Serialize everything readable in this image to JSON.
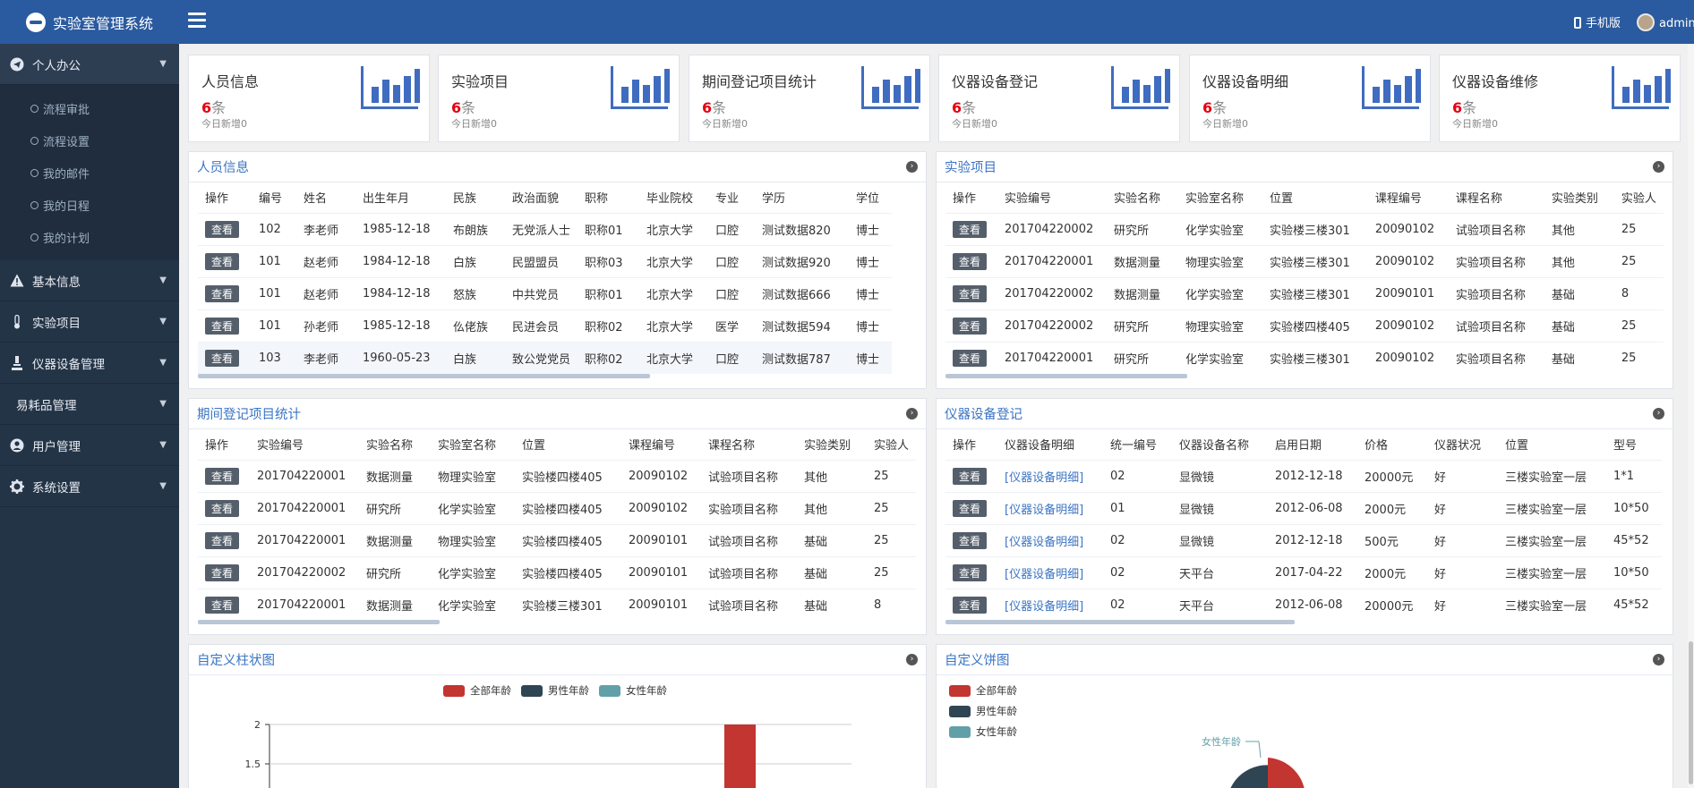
{
  "app": {
    "title": "实验室管理系统"
  },
  "topbar": {
    "mobile_label": "手机版",
    "user": "admin"
  },
  "sidebar": {
    "groups": [
      {
        "label": "个人办公",
        "icon": "send-icon",
        "items": [
          "流程审批",
          "流程设置",
          "我的邮件",
          "我的日程",
          "我的计划"
        ]
      },
      {
        "label": "基本信息",
        "icon": "warning-icon"
      },
      {
        "label": "实验项目",
        "icon": "thermometer-icon"
      },
      {
        "label": "仪器设备管理",
        "icon": "microscope-icon"
      },
      {
        "label": "易耗品管理",
        "icon": ""
      },
      {
        "label": "用户管理",
        "icon": "user-circle-icon"
      },
      {
        "label": "系统设置",
        "icon": "gear-icon"
      }
    ]
  },
  "cards": [
    {
      "title": "人员信息",
      "count": "6",
      "unit": "条",
      "today": "今日新增0"
    },
    {
      "title": "实验项目",
      "count": "6",
      "unit": "条",
      "today": "今日新增0"
    },
    {
      "title": "期间登记项目统计",
      "count": "6",
      "unit": "条",
      "today": "今日新增0"
    },
    {
      "title": "仪器设备登记",
      "count": "6",
      "unit": "条",
      "today": "今日新增0"
    },
    {
      "title": "仪器设备明细",
      "count": "6",
      "unit": "条",
      "today": "今日新增0"
    },
    {
      "title": "仪器设备维修",
      "count": "6",
      "unit": "条",
      "today": "今日新增0"
    }
  ],
  "view_label": "查看",
  "panels": {
    "personnel": {
      "title": "人员信息",
      "columns": [
        "操作",
        "编号",
        "姓名",
        "出生年月",
        "民族",
        "政治面貌",
        "职称",
        "毕业院校",
        "专业",
        "学历",
        "学位"
      ],
      "rows": [
        [
          "102",
          "李老师",
          "1985-12-18",
          "布朗族",
          "无党派人士",
          "职称01",
          "北京大学",
          "口腔",
          "测试数据820",
          "博士"
        ],
        [
          "101",
          "赵老师",
          "1984-12-18",
          "白族",
          "民盟盟员",
          "职称03",
          "北京大学",
          "口腔",
          "测试数据920",
          "博士"
        ],
        [
          "101",
          "赵老师",
          "1984-12-18",
          "怒族",
          "中共党员",
          "职称01",
          "北京大学",
          "口腔",
          "测试数据666",
          "博士"
        ],
        [
          "101",
          "孙老师",
          "1985-12-18",
          "仫佬族",
          "民进会员",
          "职称02",
          "北京大学",
          "医学",
          "测试数据594",
          "博士"
        ],
        [
          "103",
          "李老师",
          "1960-05-23",
          "白族",
          "致公党党员",
          "职称02",
          "北京大学",
          "口腔",
          "测试数据787",
          "博士"
        ]
      ]
    },
    "projects": {
      "title": "实验项目",
      "columns": [
        "操作",
        "实验编号",
        "实验名称",
        "实验室名称",
        "位置",
        "课程编号",
        "课程名称",
        "实验类别",
        "实验人"
      ],
      "rows": [
        [
          "201704220002",
          "研究所",
          "化学实验室",
          "实验楼三楼301",
          "20090102",
          "试验项目名称",
          "其他",
          "25"
        ],
        [
          "201704220001",
          "数据测量",
          "物理实验室",
          "实验楼三楼301",
          "20090102",
          "实验项目名称",
          "其他",
          "25"
        ],
        [
          "201704220002",
          "数据测量",
          "化学实验室",
          "实验楼三楼301",
          "20090101",
          "实验项目名称",
          "基础",
          "8"
        ],
        [
          "201704220002",
          "研究所",
          "物理实验室",
          "实验楼四楼405",
          "20090102",
          "试验项目名称",
          "基础",
          "25"
        ],
        [
          "201704220001",
          "研究所",
          "化学实验室",
          "实验楼三楼301",
          "20090102",
          "实验项目名称",
          "基础",
          "25"
        ]
      ]
    },
    "period": {
      "title": "期间登记项目统计",
      "columns": [
        "操作",
        "实验编号",
        "实验名称",
        "实验室名称",
        "位置",
        "课程编号",
        "课程名称",
        "实验类别",
        "实验人"
      ],
      "rows": [
        [
          "201704220001",
          "数据测量",
          "物理实验室",
          "实验楼四楼405",
          "20090102",
          "试验项目名称",
          "其他",
          "25"
        ],
        [
          "201704220001",
          "研究所",
          "化学实验室",
          "实验楼四楼405",
          "20090102",
          "实验项目名称",
          "其他",
          "25"
        ],
        [
          "201704220001",
          "数据测量",
          "物理实验室",
          "实验楼四楼405",
          "20090101",
          "试验项目名称",
          "基础",
          "25"
        ],
        [
          "201704220002",
          "研究所",
          "化学实验室",
          "实验楼四楼405",
          "20090101",
          "试验项目名称",
          "基础",
          "25"
        ],
        [
          "201704220001",
          "数据测量",
          "化学实验室",
          "实验楼三楼301",
          "20090101",
          "试验项目名称",
          "基础",
          "8"
        ]
      ]
    },
    "equipment": {
      "title": "仪器设备登记",
      "columns": [
        "操作",
        "仪器设备明细",
        "统一编号",
        "仪器设备名称",
        "启用日期",
        "价格",
        "仪器状况",
        "位置",
        "型号"
      ],
      "rows": [
        [
          "[仪器设备明细]",
          "02",
          "显微镜",
          "2012-12-18",
          "20000元",
          "好",
          "三楼实验室一层",
          "1*1"
        ],
        [
          "[仪器设备明细]",
          "01",
          "显微镜",
          "2012-06-08",
          "2000元",
          "好",
          "三楼实验室一层",
          "10*50"
        ],
        [
          "[仪器设备明细]",
          "02",
          "显微镜",
          "2012-12-18",
          "500元",
          "好",
          "三楼实验室一层",
          "45*52"
        ],
        [
          "[仪器设备明细]",
          "02",
          "天平台",
          "2017-04-22",
          "2000元",
          "好",
          "三楼实验室一层",
          "10*50"
        ],
        [
          "[仪器设备明细]",
          "02",
          "天平台",
          "2012-06-08",
          "20000元",
          "好",
          "三楼实验室一层",
          "45*52"
        ]
      ]
    },
    "bar_chart": {
      "title": "自定义柱状图"
    },
    "pie_chart": {
      "title": "自定义饼图"
    }
  },
  "chart_data": [
    {
      "type": "bar",
      "title": "",
      "series": [
        {
          "name": "全部年龄",
          "color": "#c23531"
        },
        {
          "name": "男性年龄",
          "color": "#2f4554"
        },
        {
          "name": "女性年龄",
          "color": "#61a0a8"
        }
      ],
      "visible_y_ticks": [
        "2",
        "1.5"
      ],
      "visible_bar": {
        "series": "全部年龄",
        "value": 2
      }
    },
    {
      "type": "pie",
      "title": "",
      "legend": [
        {
          "name": "全部年龄",
          "color": "#c23531"
        },
        {
          "name": "男性年龄",
          "color": "#2f4554"
        },
        {
          "name": "女性年龄",
          "color": "#61a0a8"
        }
      ],
      "visible_label": "女性年龄"
    }
  ]
}
